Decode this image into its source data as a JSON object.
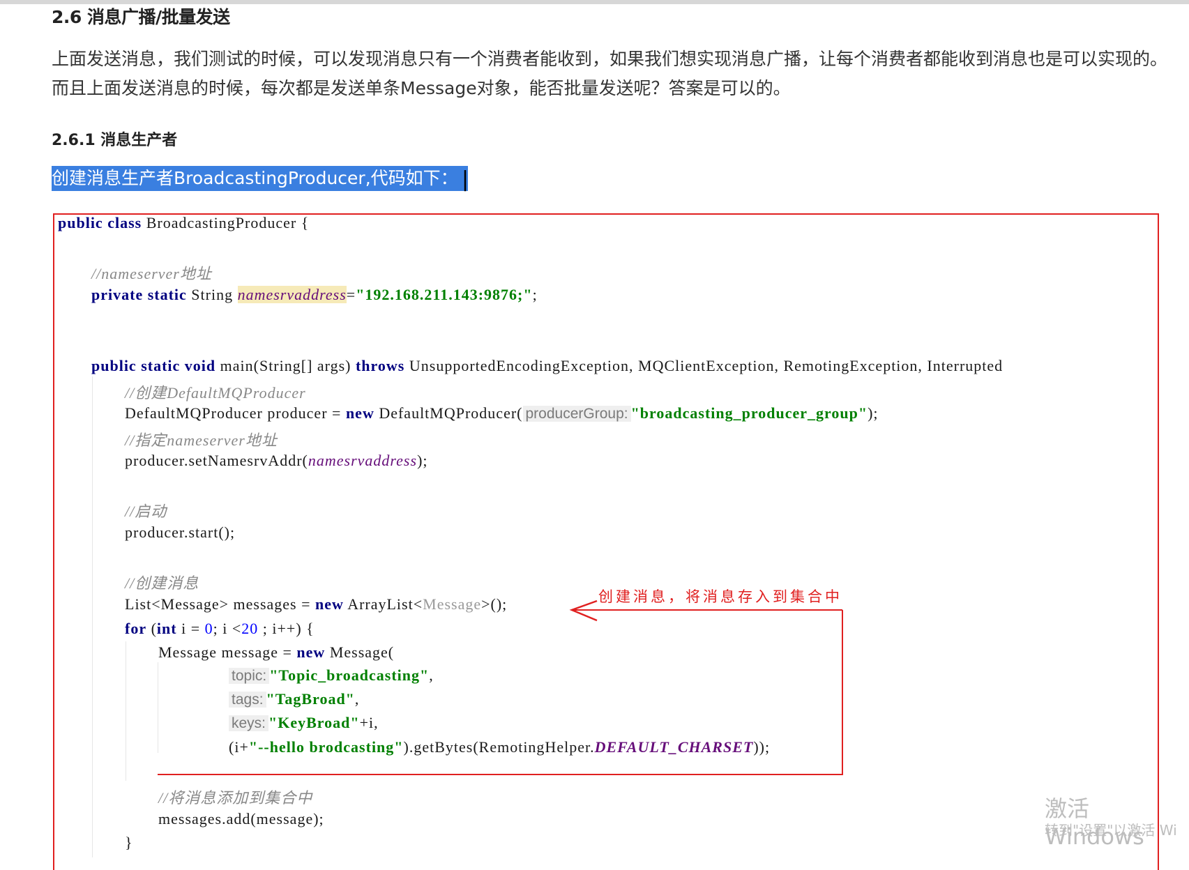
{
  "section": {
    "heading": "2.6 消息广播/批量发送",
    "paragraph": "上面发送消息，我们测试的时候，可以发现消息只有一个消费者能收到，如果我们想实现消息广播，让每个消费者都能收到消息也是可以实现的。而且上面发送消息的时候，每次都是发送单条Message对象，能否批量发送呢？答案是可以的。",
    "sub_heading": "2.6.1 消息生产者",
    "selected_line": "创建消息生产者BroadcastingProducer,代码如下："
  },
  "code": {
    "l1_kw": "public class",
    "l1_rest": " BroadcastingProducer {",
    "c_nameserver": "//nameserver地址",
    "l2_kw": "private static",
    "l2_type": " String ",
    "l2_field": "namesrvaddress",
    "l2_eq": "=",
    "l2_str": "\"192.168.211.143:9876;\"",
    "l2_end": ";",
    "l3_kw": "public static void",
    "l3_rest": " main(String[] args) ",
    "l3_throws": "throws",
    "l3_ex": " UnsupportedEncodingException, MQClientException, RemotingException, Interrupted",
    "c_create_producer": "//创建DefaultMQProducer",
    "l4_a": "DefaultMQProducer producer = ",
    "l4_new": "new",
    "l4_b": " DefaultMQProducer(",
    "l4_hint": "producerGroup:",
    "l4_str": "\"broadcasting_producer_group\"",
    "l4_end": ");",
    "c_set_ns": "//指定nameserver地址",
    "l5_a": "producer.setNamesrvAddr(",
    "l5_field": "namesrvaddress",
    "l5_end": ");",
    "c_start": "//启动",
    "l6": "producer.start();",
    "c_create_msg": "//创建消息",
    "l7_a": "List<Message> messages = ",
    "l7_new": "new",
    "l7_b": " ArrayList<",
    "l7_gen": "Message",
    "l7_end": ">();",
    "l8_for": "for",
    "l8_a": " (",
    "l8_int": "int",
    "l8_b": " i = ",
    "l8_zero": "0",
    "l8_c": "; i <",
    "l8_twenty": "20",
    "l8_d": " ; i++) {",
    "l9_a": "Message message = ",
    "l9_new": "new",
    "l9_b": " Message(",
    "l10_hint": "topic:",
    "l10_str": "\"Topic_broadcasting\"",
    "l10_end": ",",
    "l11_hint": "tags:",
    "l11_str": "\"TagBroad\"",
    "l11_end": ",",
    "l12_hint": "keys:",
    "l12_str": "\"KeyBroad\"",
    "l12_end": "+i,",
    "l13_a": "(i+",
    "l13_str": "\"--hello brodcasting\"",
    "l13_b": ").getBytes(RemotingHelper.",
    "l13_const": "DEFAULT_CHARSET",
    "l13_end": "));",
    "c_add": "//将消息添加到集合中",
    "l14": "messages.add(message);",
    "l15": "}"
  },
  "annotation": {
    "text": "创建消息，将消息存入到集合中",
    "color": "#e02020"
  },
  "watermark": {
    "line1": "激活 Windows",
    "line2": "转到\"设置\"以激活 Wi"
  }
}
